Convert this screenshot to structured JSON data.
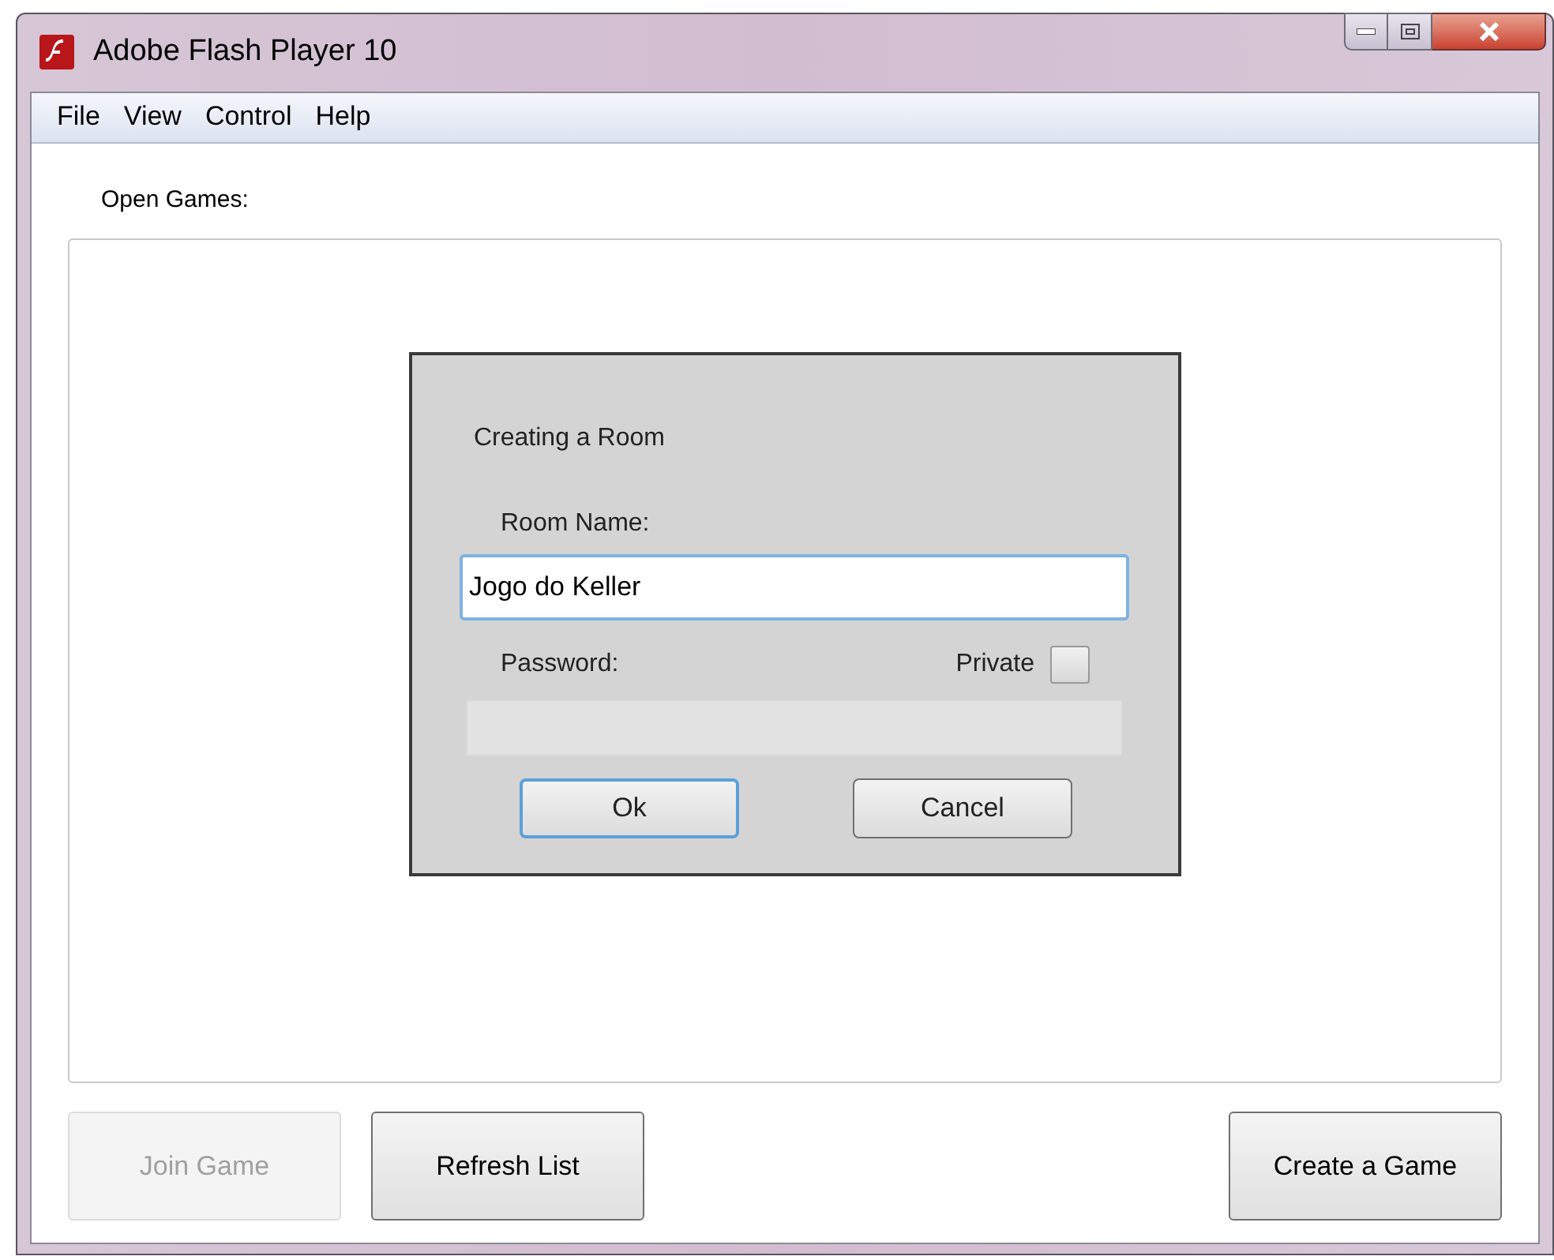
{
  "window": {
    "title": "Adobe Flash Player 10"
  },
  "menu": [
    "File",
    "View",
    "Control",
    "Help"
  ],
  "list_label": "Open Games:",
  "dialog": {
    "title": "Creating a Room",
    "room_name_label": "Room Name:",
    "room_name": "Jogo do Keller",
    "password_label": "Password:",
    "password_disabled": true,
    "private_label": "Private",
    "private_checked": false,
    "buttons": [
      {
        "label": "Ok",
        "focused": true
      },
      {
        "label": "Cancel",
        "focused": false
      }
    ]
  },
  "buttons": [
    {
      "label": "Join Game",
      "disabled": true
    },
    {
      "label": "Refresh List",
      "disabled": false
    },
    {
      "label": "Create a Game",
      "disabled": false
    }
  ]
}
